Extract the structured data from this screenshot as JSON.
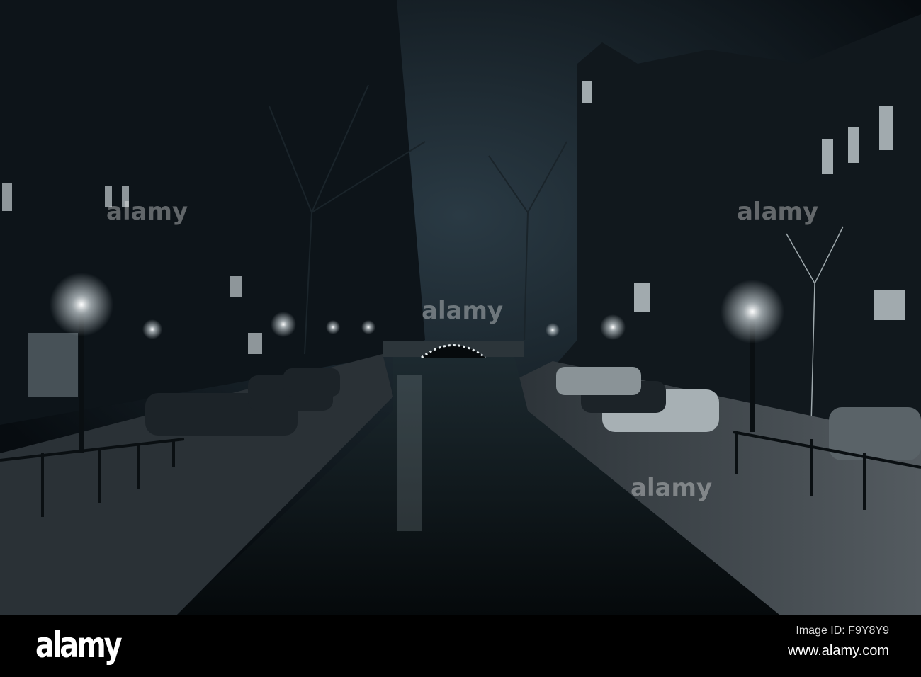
{
  "photo": {
    "subject": "Night canal scene",
    "palette": {
      "sky": "#0f1d26",
      "buildings": "#121a20",
      "water": "#0b1216",
      "lamp": "#f4f6f2",
      "quay": "#3a4146"
    }
  },
  "watermark": {
    "text": "alamy"
  },
  "footer": {
    "logo": "alamy",
    "image_id": "Image ID: F9Y8Y9",
    "site": "www.alamy.com"
  }
}
